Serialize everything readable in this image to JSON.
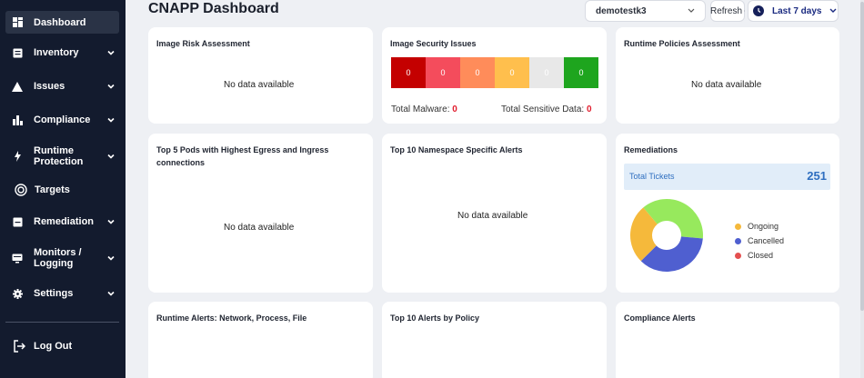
{
  "sidebar": {
    "items": [
      {
        "label": "Dashboard"
      },
      {
        "label": "Inventory"
      },
      {
        "label": "Issues"
      },
      {
        "label": "Compliance"
      },
      {
        "label": "Runtime Protection"
      },
      {
        "label": "Targets"
      },
      {
        "label": "Remediation"
      },
      {
        "label": "Monitors / Logging"
      },
      {
        "label": "Settings"
      }
    ],
    "logout_label": "Log Out"
  },
  "header": {
    "title": "CNAPP Dashboard",
    "tenant": "demotestk3",
    "refresh_label": "Refresh",
    "range_label": "Last 7 days"
  },
  "cards": {
    "image_risk": {
      "title": "Image Risk Assessment",
      "empty": "No data available"
    },
    "image_security": {
      "title": "Image Security Issues",
      "severities": [
        {
          "value": "0",
          "color": "#c40000"
        },
        {
          "value": "0",
          "color": "#f44c5c"
        },
        {
          "value": "0",
          "color": "#ff8c5a"
        },
        {
          "value": "0",
          "color": "#ffbf4d"
        },
        {
          "value": "0",
          "color": "#e8e8e8"
        },
        {
          "value": "0",
          "color": "#1ea51e"
        }
      ],
      "malware_label": "Total Malware:",
      "malware_value": "0",
      "sensitive_label": "Total Sensitive Data:",
      "sensitive_value": "0"
    },
    "runtime_policies": {
      "title": "Runtime Policies Assessment",
      "empty": "No data available"
    },
    "top_pods": {
      "title": "Top 5 Pods with Highest Egress and Ingress connections",
      "empty": "No data available"
    },
    "namespace_alerts": {
      "title": "Top 10 Namespace Specific Alerts",
      "empty": "No data available"
    },
    "remediations": {
      "title": "Remediations",
      "tickets_label": "Total Tickets",
      "tickets_value": "251",
      "legend": [
        {
          "label": "Ongoing",
          "color": "#f5b93b"
        },
        {
          "label": "Cancelled",
          "color": "#4f5fd0"
        },
        {
          "label": "Closed",
          "color": "#e45050"
        }
      ],
      "donut_colors": {
        "green": "#97e95d",
        "blue": "#4f5fd0",
        "yellow": "#f5b93b"
      }
    },
    "runtime_alerts": {
      "title": "Runtime Alerts: Network, Process, File"
    },
    "alerts_by_policy": {
      "title": "Top 10 Alerts by Policy"
    },
    "compliance_alerts": {
      "title": "Compliance Alerts"
    }
  }
}
